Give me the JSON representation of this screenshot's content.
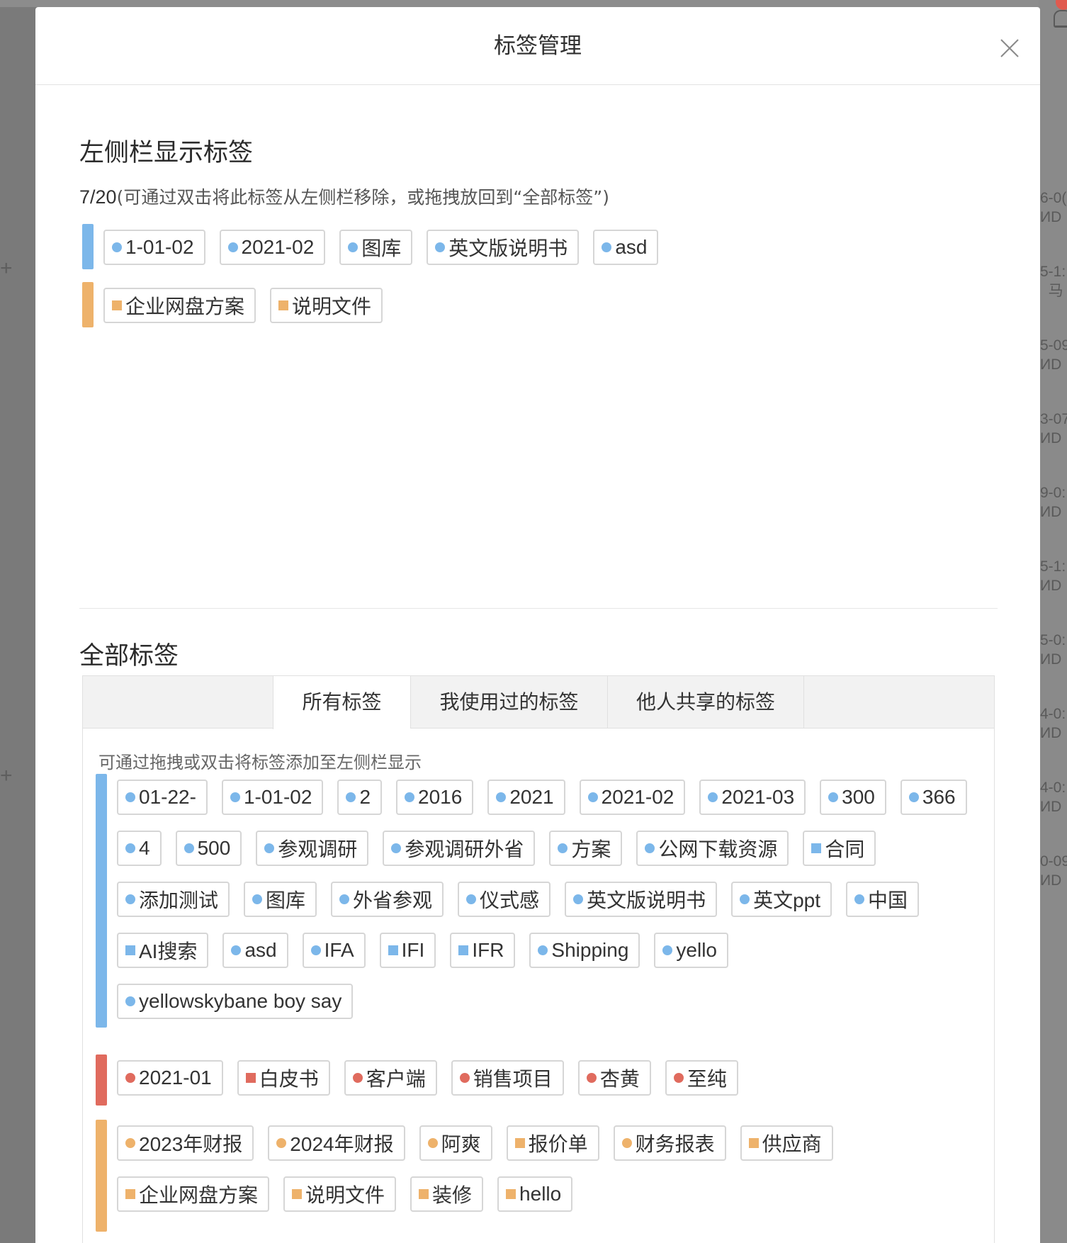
{
  "colors": {
    "blue": "#7cb7ea",
    "orange": "#eeb26b",
    "red": "#e06b5e",
    "yellow": "#f2de6b"
  },
  "background": {
    "fragments": [
      {
        "line1": "6-0(",
        "line2": "ИD"
      },
      {
        "line1": "5-1:",
        "line2": "  马"
      },
      {
        "line1": "5-09",
        "line2": "ИD"
      },
      {
        "line1": "3-07",
        "line2": "ИD"
      },
      {
        "line1": "9-0:",
        "line2": "ИD"
      },
      {
        "line1": "5-1:",
        "line2": "ИD"
      },
      {
        "line1": "5-0:",
        "line2": "ИD"
      },
      {
        "line1": "4-0:",
        "line2": "ИD"
      },
      {
        "line1": "4-0:",
        "line2": "ИD"
      },
      {
        "line1": "0-09",
        "line2": "ИD"
      }
    ],
    "plus_1": "+",
    "plus_2": "+"
  },
  "modal": {
    "title": "标签管理",
    "close_icon": "close-icon"
  },
  "sidebar_section": {
    "title": "左侧栏显示标签",
    "count": "7/20",
    "hint": "(可通过双击将此标签从左侧栏移除，或拖拽放回到“全部标签”)",
    "groups": [
      {
        "color": "blue",
        "rows": [
          [
            {
              "label": "1-01-02",
              "icon": "circle"
            },
            {
              "label": "2021-02",
              "icon": "circle"
            },
            {
              "label": "图库",
              "icon": "circle"
            },
            {
              "label": "英文版说明书",
              "icon": "circle"
            },
            {
              "label": "asd",
              "icon": "circle"
            }
          ]
        ]
      },
      {
        "color": "orange",
        "rows": [
          [
            {
              "label": "企业网盘方案",
              "icon": "square"
            },
            {
              "label": "说明文件",
              "icon": "square"
            }
          ]
        ]
      }
    ]
  },
  "all_section": {
    "title": "全部标签",
    "tabs": [
      {
        "label": "所有标签",
        "active": true
      },
      {
        "label": "我使用过的标签",
        "active": false
      },
      {
        "label": "他人共享的标签",
        "active": false
      }
    ],
    "hint": "可通过拖拽或双击将标签添加至左侧栏显示",
    "groups": [
      {
        "color": "blue",
        "rows": [
          [
            {
              "label": "01-22-",
              "icon": "circle"
            },
            {
              "label": "1-01-02",
              "icon": "circle"
            },
            {
              "label": "2",
              "icon": "circle"
            },
            {
              "label": "2016",
              "icon": "circle"
            },
            {
              "label": "2021",
              "icon": "circle"
            },
            {
              "label": "2021-02",
              "icon": "circle"
            },
            {
              "label": "2021-03",
              "icon": "circle"
            },
            {
              "label": "300",
              "icon": "circle"
            },
            {
              "label": "366",
              "icon": "circle"
            }
          ],
          [
            {
              "label": "4",
              "icon": "circle"
            },
            {
              "label": "500",
              "icon": "circle"
            },
            {
              "label": "参观调研",
              "icon": "circle"
            },
            {
              "label": "参观调研外省",
              "icon": "circle"
            },
            {
              "label": "方案",
              "icon": "circle"
            },
            {
              "label": "公网下载资源",
              "icon": "circle"
            },
            {
              "label": "合同",
              "icon": "square"
            }
          ],
          [
            {
              "label": "添加测试",
              "icon": "circle"
            },
            {
              "label": "图库",
              "icon": "circle"
            },
            {
              "label": "外省参观",
              "icon": "circle"
            },
            {
              "label": "仪式感",
              "icon": "circle"
            },
            {
              "label": "英文版说明书",
              "icon": "circle"
            },
            {
              "label": "英文ppt",
              "icon": "circle"
            },
            {
              "label": "中国",
              "icon": "circle"
            }
          ],
          [
            {
              "label": "AI搜索",
              "icon": "square"
            },
            {
              "label": "asd",
              "icon": "circle"
            },
            {
              "label": "IFA",
              "icon": "circle"
            },
            {
              "label": "IFI",
              "icon": "square"
            },
            {
              "label": "IFR",
              "icon": "square"
            },
            {
              "label": "Shipping",
              "icon": "circle"
            },
            {
              "label": "yello",
              "icon": "circle"
            }
          ],
          [
            {
              "label": "yellowskybane boy say",
              "icon": "circle"
            }
          ]
        ]
      },
      {
        "color": "red",
        "rows": [
          [
            {
              "label": "2021-01",
              "icon": "circle"
            },
            {
              "label": "白皮书",
              "icon": "square"
            },
            {
              "label": "客户端",
              "icon": "circle"
            },
            {
              "label": "销售项目",
              "icon": "circle"
            },
            {
              "label": "杏黄",
              "icon": "circle"
            },
            {
              "label": "至纯",
              "icon": "circle"
            }
          ]
        ]
      },
      {
        "color": "orange",
        "rows": [
          [
            {
              "label": "2023年财报",
              "icon": "circle"
            },
            {
              "label": "2024年财报",
              "icon": "circle"
            },
            {
              "label": "阿爽",
              "icon": "circle"
            },
            {
              "label": "报价单",
              "icon": "square"
            },
            {
              "label": "财务报表",
              "icon": "circle"
            },
            {
              "label": "供应商",
              "icon": "square"
            }
          ],
          [
            {
              "label": "企业网盘方案",
              "icon": "square"
            },
            {
              "label": "说明文件",
              "icon": "square"
            },
            {
              "label": "装修",
              "icon": "square"
            },
            {
              "label": "hello",
              "icon": "square"
            }
          ]
        ]
      },
      {
        "color": "yellow",
        "rows": []
      }
    ]
  }
}
